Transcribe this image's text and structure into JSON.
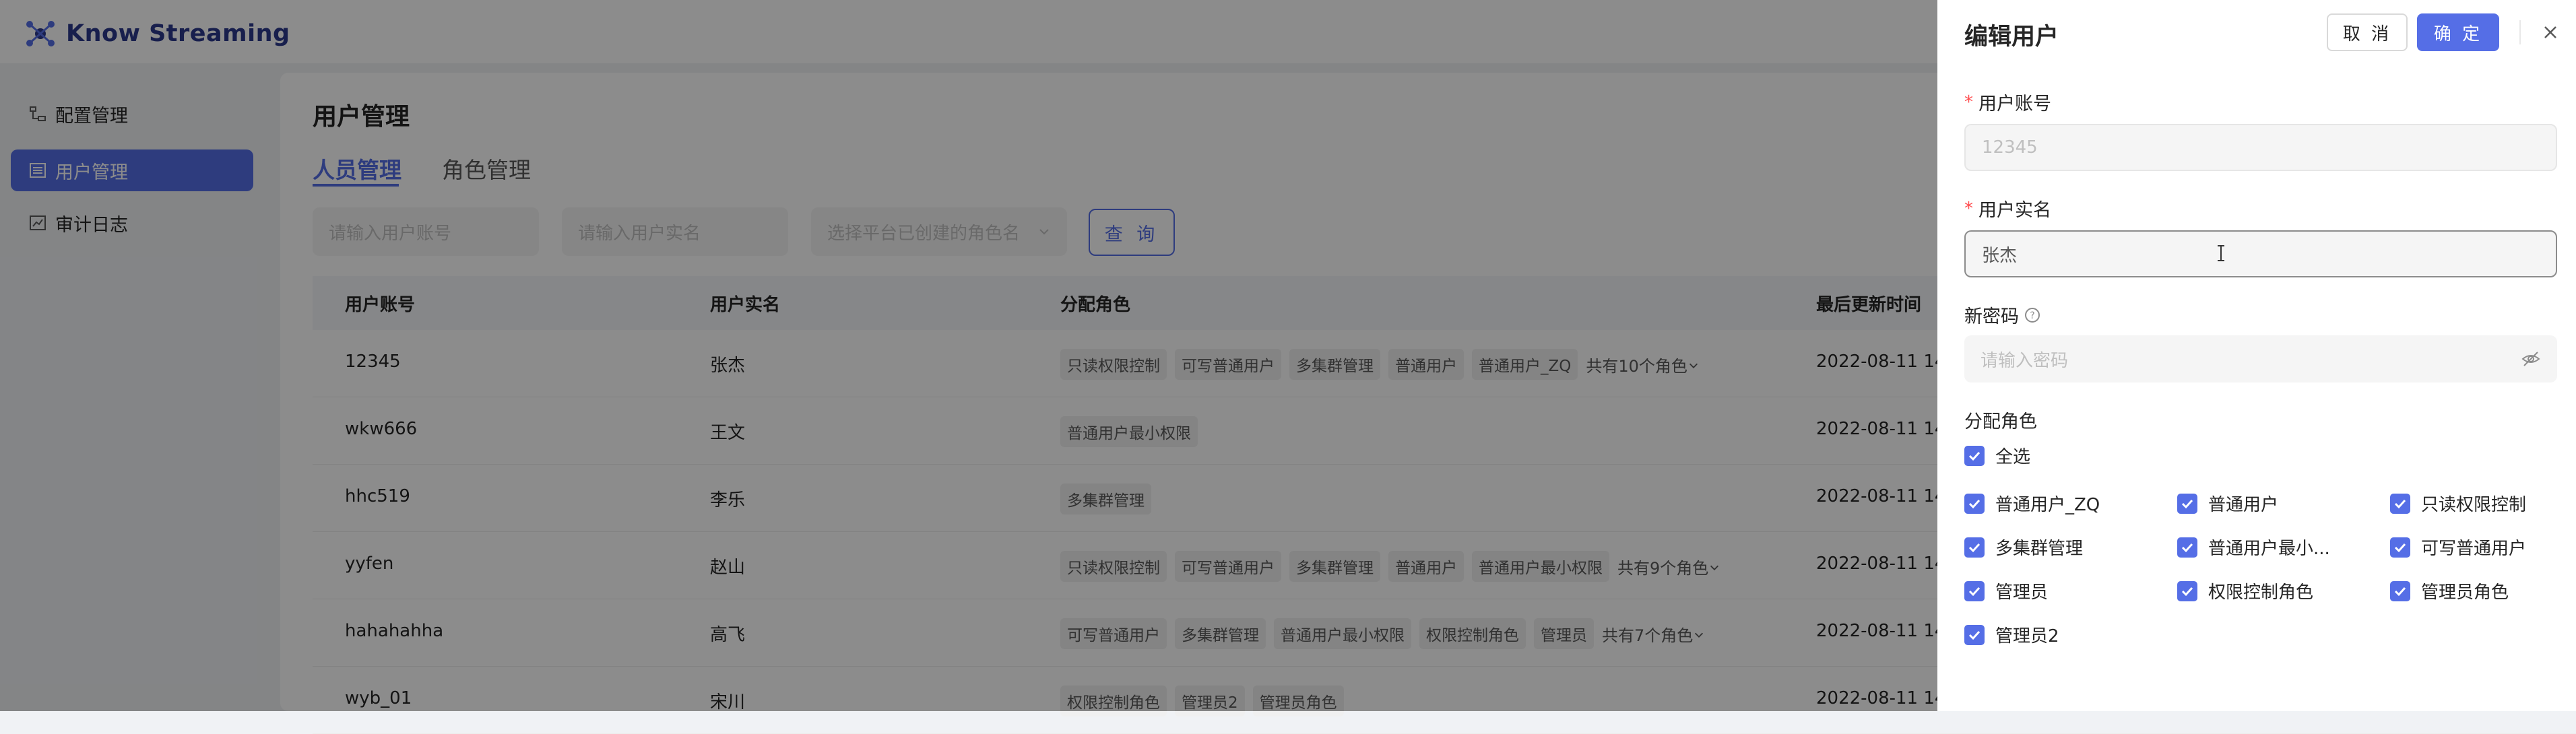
{
  "app": {
    "name": "Know Streaming"
  },
  "sidebar": {
    "items": [
      {
        "label": "配置管理",
        "icon": "config-icon"
      },
      {
        "label": "用户管理",
        "icon": "user-list-icon"
      },
      {
        "label": "审计日志",
        "icon": "audit-chart-icon"
      }
    ]
  },
  "page": {
    "title": "用户管理",
    "tabs": [
      {
        "label": "人员管理"
      },
      {
        "label": "角色管理"
      }
    ],
    "filters": {
      "account_placeholder": "请输入用户账号",
      "realname_placeholder": "请输入用户实名",
      "role_placeholder": "选择平台已创建的角色名",
      "query_label": "查 询"
    },
    "table": {
      "headers": [
        "用户账号",
        "用户实名",
        "分配角色",
        "最后更新时间"
      ],
      "rows": [
        {
          "account": "12345",
          "name": "张杰",
          "roles": [
            "只读权限控制",
            "可写普通用户",
            "多集群管理",
            "普通用户",
            "普通用户_ZQ"
          ],
          "more": "共有10个角色",
          "time": "2022-08-11 14:"
        },
        {
          "account": "wkw666",
          "name": "王文",
          "roles": [
            "普通用户最小权限"
          ],
          "more": "",
          "time": "2022-08-11 14:"
        },
        {
          "account": "hhc519",
          "name": "李乐",
          "roles": [
            "多集群管理"
          ],
          "more": "",
          "time": "2022-08-11 14:"
        },
        {
          "account": "yyfen",
          "name": "赵山",
          "roles": [
            "只读权限控制",
            "可写普通用户",
            "多集群管理",
            "普通用户",
            "普通用户最小权限"
          ],
          "more": "共有9个角色",
          "time": "2022-08-11 14:"
        },
        {
          "account": "hahahahha",
          "name": "高飞",
          "roles": [
            "可写普通用户",
            "多集群管理",
            "普通用户最小权限",
            "权限控制角色",
            "管理员"
          ],
          "more": "共有7个角色",
          "time": "2022-08-11 14:"
        },
        {
          "account": "wyb_01",
          "name": "宋川",
          "roles": [
            "权限控制角色",
            "管理员2",
            "管理员角色"
          ],
          "more": "",
          "time": "2022-08-11 14:"
        }
      ]
    }
  },
  "drawer": {
    "title": "编辑用户",
    "cancel_label": "取 消",
    "ok_label": "确 定",
    "account_label": "用户账号",
    "account_value": "12345",
    "realname_label": "用户实名",
    "realname_value": "张杰",
    "password_label": "新密码",
    "password_placeholder": "请输入密码",
    "roles_label": "分配角色",
    "select_all_label": "全选",
    "roles": [
      "普通用户_ZQ",
      "普通用户",
      "只读权限控制",
      "多集群管理",
      "普通用户最小...",
      "可写普通用户",
      "管理员",
      "权限控制角色",
      "管理员角色",
      "管理员2"
    ]
  },
  "colors": {
    "primary": "#556ee6",
    "required": "#ff4d4f"
  }
}
